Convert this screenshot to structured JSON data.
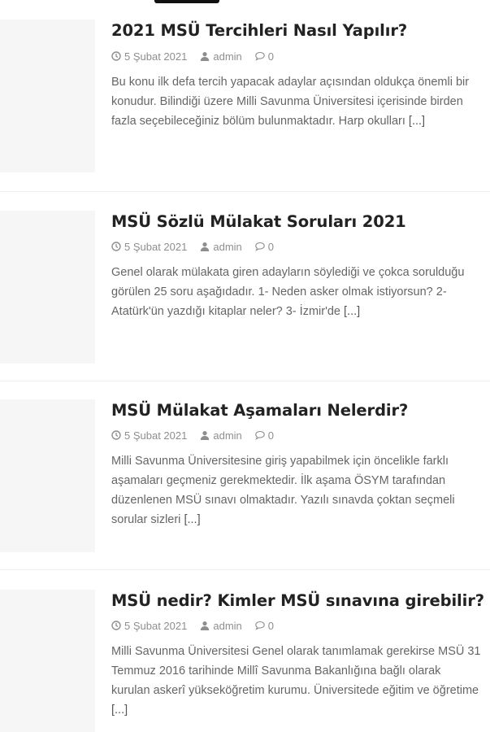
{
  "posts": [
    {
      "title": "2021 MSÜ Tercihleri Nasıl Yapılır?",
      "date": "5 Şubat 2021",
      "author": "admin",
      "comments": "0",
      "excerpt": "Bu konu ilk defa tercih yapacak adaylar açısından oldukça önemli bir konudur. Bilindiği üzere Milli Savunma Üniversitesi içerisinde birden fazla seçebileceğiniz bölüm bulunmaktadır. Harp okulları",
      "more": "[...]"
    },
    {
      "title": "MSÜ Sözlü Mülakat Soruları 2021",
      "date": "5 Şubat 2021",
      "author": "admin",
      "comments": "0",
      "excerpt": "Genel olarak mülakata giren adayların söylediği ve çokca sorulduğu görülen 25 soru aşağıdadır. 1- Neden asker olmak istiyorsun? 2- Atatürk'ün yazdığı kitaplar neler? 3- İzmir'de",
      "more": "[...]"
    },
    {
      "title": "MSÜ Mülakat Aşamaları Nelerdir?",
      "date": "5 Şubat 2021",
      "author": "admin",
      "comments": "0",
      "excerpt": "Milli Savunma Üniversitesine giriş yapabilmek için öncelikle farklı aşamaları geçmeniz gerekmektedir. İlk aşama ÖSYM tarafından düzenlenen MSÜ sınavı olmaktadır. Yazılı sınavda çoktan seçmeli sorular sizleri",
      "more": "[...]"
    },
    {
      "title": "MSÜ nedir? Kimler MSÜ sınavına girebilir?",
      "date": "5 Şubat 2021",
      "author": "admin",
      "comments": "0",
      "excerpt": "Milli Savunma Üniversitesi Genel olarak tanımlamak gerekirse MSÜ 31 Temmuz 2016 tarihinde Millî Savunma Bakanlığına bağlı olarak kurulan askerî yükseköğretim kurumu. Üniversitede eğitim ve öğretime",
      "more": "[...]"
    }
  ],
  "icons": {
    "date": "clock-icon",
    "author": "user-icon",
    "comments": "comment-icon"
  },
  "colors": {
    "title": "#222222",
    "meta": "#8e8e8e",
    "excerpt": "#666666",
    "thumb": "#f6f6f6"
  }
}
